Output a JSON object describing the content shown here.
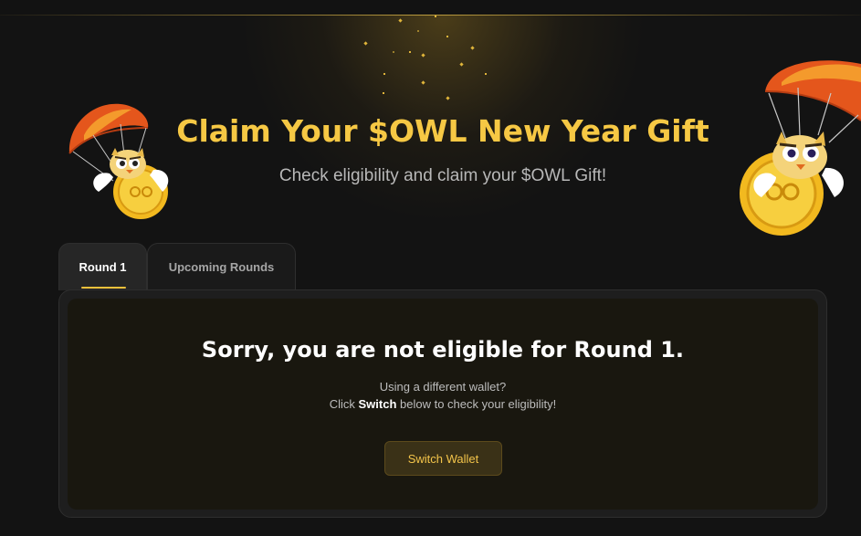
{
  "header": {
    "title": "Claim Your $OWL New Year Gift",
    "subtitle": "Check eligibility and claim your $OWL Gift!"
  },
  "tabs": [
    {
      "label": "Round 1",
      "active": true
    },
    {
      "label": "Upcoming Rounds",
      "active": false
    }
  ],
  "panel": {
    "title": "Sorry, you are not eligible for Round 1.",
    "line1": "Using a different wallet?",
    "line2_prefix": "Click ",
    "line2_strong": "Switch",
    "line2_suffix": " below to check your eligibility!",
    "button_label": "Switch Wallet"
  },
  "icons": {
    "left_mascot": "owl-parachute-coin-icon",
    "right_mascot": "owl-parachute-coin-icon"
  },
  "colors": {
    "accent": "#f6c844",
    "background": "#131313",
    "panel": "#19170f",
    "button_bg": "#3a3117",
    "button_text": "#f3c44a"
  }
}
